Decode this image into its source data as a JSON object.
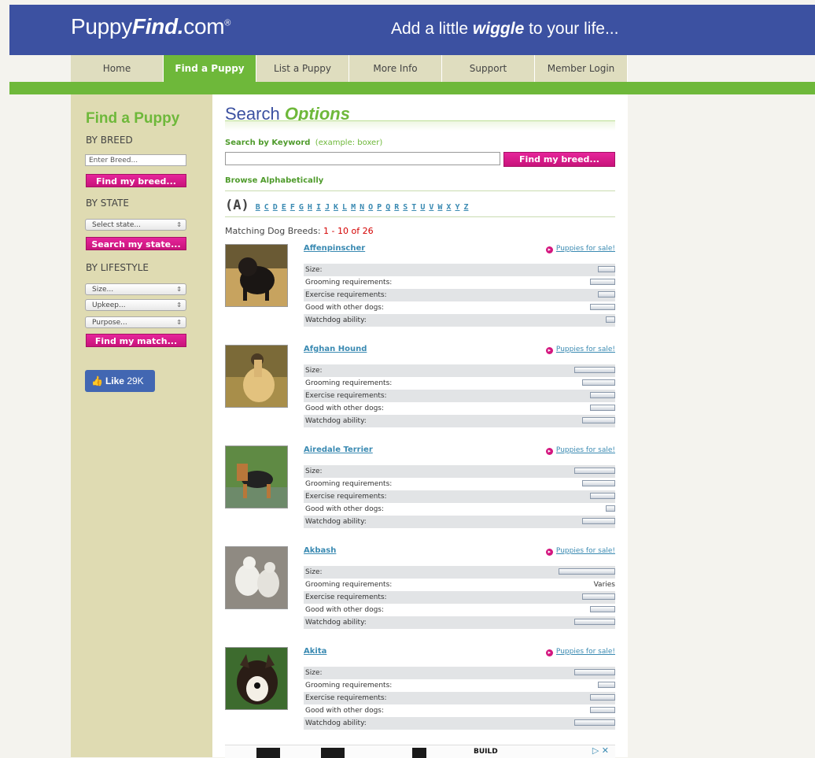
{
  "header": {
    "logo_prefix": "Puppy",
    "logo_bold": "Find.",
    "logo_suffix": "com",
    "logo_reg": "®",
    "tagline_pre": "Add a little ",
    "tagline_bold": "wiggle",
    "tagline_post": " to your life..."
  },
  "nav": {
    "items": [
      {
        "label": "Home"
      },
      {
        "label": "Find a Puppy"
      },
      {
        "label": "List a Puppy"
      },
      {
        "label": "More Info"
      },
      {
        "label": "Support"
      },
      {
        "label": "Member Login"
      }
    ]
  },
  "sidebar": {
    "title": "Find a Puppy",
    "by_breed": "BY BREED",
    "breed_placeholder": "Enter Breed...",
    "breed_button": "Find my breed...",
    "by_state": "BY STATE",
    "state_select": "Select state...",
    "state_button": "Search my state...",
    "by_lifestyle": "BY LIFESTYLE",
    "size_select": "Size...",
    "upkeep_select": "Upkeep...",
    "purpose_select": "Purpose...",
    "match_button": "Find my match...",
    "like_label": "Like",
    "like_count": "29K"
  },
  "main": {
    "title_plain": "Search ",
    "title_bold": "Options",
    "keyword_label": "Search by Keyword",
    "keyword_example": "(example: boxer)",
    "keyword_button": "Find my breed...",
    "browse_label": "Browse Alphabetically",
    "current_letter": "(A)",
    "letters": [
      "B",
      "C",
      "D",
      "E",
      "F",
      "G",
      "H",
      "I",
      "J",
      "K",
      "L",
      "M",
      "N",
      "O",
      "P",
      "Q",
      "R",
      "S",
      "T",
      "U",
      "V",
      "W",
      "X",
      "Y",
      "Z"
    ],
    "matching_label": "Matching Dog Breeds:",
    "matching_range": "1 - 10 of 26",
    "puppies_link": "Puppies for sale!",
    "attr_labels": [
      "Size:",
      "Grooming requirements:",
      "Exercise requirements:",
      "Good with other dogs:",
      "Watchdog ability:"
    ]
  },
  "breeds": [
    {
      "name": "Affenpinscher",
      "ratings": [
        2,
        3,
        2,
        3,
        1
      ],
      "texts": [
        "",
        "",
        "",
        "",
        ""
      ]
    },
    {
      "name": "Afghan Hound",
      "ratings": [
        5,
        4,
        3,
        3,
        4
      ],
      "texts": [
        "",
        "",
        "",
        "",
        ""
      ]
    },
    {
      "name": "Airedale Terrier",
      "ratings": [
        5,
        4,
        3,
        1,
        4
      ],
      "texts": [
        "",
        "",
        "",
        "",
        ""
      ]
    },
    {
      "name": "Akbash",
      "ratings": [
        7,
        0,
        4,
        3,
        5
      ],
      "texts": [
        "",
        "Varies",
        "",
        "",
        ""
      ]
    },
    {
      "name": "Akita",
      "ratings": [
        5,
        2,
        3,
        3,
        5
      ],
      "texts": [
        "",
        "",
        "",
        "",
        ""
      ]
    }
  ],
  "ad": {
    "text": "BUILD",
    "close": "▷ ✕"
  },
  "colors": {
    "brand_blue": "#3c51a1",
    "brand_green": "#6eb83a",
    "button_pink": "#d4167f",
    "link_blue": "#3a8ab2"
  }
}
